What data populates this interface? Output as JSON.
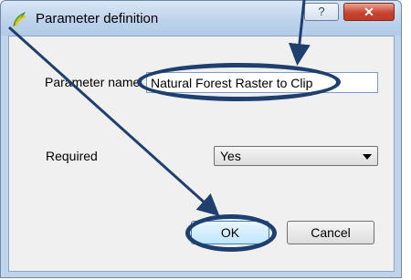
{
  "window": {
    "title": "Parameter definition",
    "help_label": "?",
    "close_label": "✕"
  },
  "form": {
    "name_label": "Parameter name",
    "name_value": "Natural Forest Raster to Clip",
    "required_label": "Required",
    "required_value": "Yes"
  },
  "buttons": {
    "ok_label": "OK",
    "cancel_label": "Cancel"
  },
  "colors": {
    "annotation": "#1f3f6e",
    "close_button": "#c0392b"
  }
}
